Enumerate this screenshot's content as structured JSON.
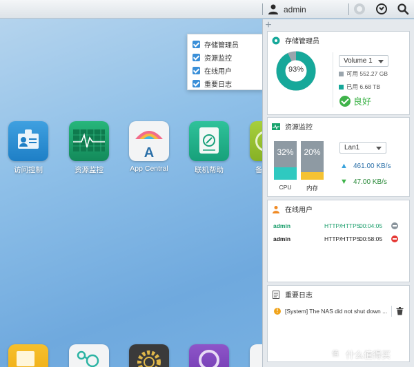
{
  "topbar": {
    "username": "admin",
    "icons": [
      "user-icon",
      "notification-icon",
      "options-icon",
      "search-icon"
    ]
  },
  "desktop": {
    "apps": [
      {
        "name": "access-control",
        "label": "访问控制"
      },
      {
        "name": "resource-monitor",
        "label": "资源监控"
      },
      {
        "name": "app-central",
        "label": "App Central"
      },
      {
        "name": "online-help",
        "label": "联机帮助"
      },
      {
        "name": "partial-app",
        "label": "备"
      }
    ]
  },
  "chooser": {
    "options": [
      "存储管理员",
      "资源监控",
      "在线用户",
      "重要日志"
    ]
  },
  "storage": {
    "title": "存储管理员",
    "percent": "93%",
    "percent_value": 93,
    "volume": "Volume 1",
    "available_label": "可用",
    "available_value": "552.27 GB",
    "used_label": "已用",
    "used_value": "6.68 TB",
    "status": "良好",
    "colors": {
      "used": "#16a89a",
      "free": "#9aa5ad"
    }
  },
  "resource": {
    "title": "资源监控",
    "cpu_percent": "32%",
    "cpu_value": 32,
    "cpu_label": "CPU",
    "mem_percent": "20%",
    "mem_value": 20,
    "mem_label": "内存",
    "lan": "Lan1",
    "upload": "461.00 KB/s",
    "download": "47.00 KB/s",
    "colors": {
      "cpu": "#2fc9c0",
      "mem": "#f5c233"
    }
  },
  "online": {
    "title": "在线用户",
    "users": [
      {
        "name": "admin",
        "protocol": "HTTP/HTTPS",
        "time": "00:04:05",
        "color": "#1a9e6b",
        "btn": "#8a949c"
      },
      {
        "name": "admin",
        "protocol": "HTTP/HTTPS",
        "time": "00:58:05",
        "color": "#222222",
        "btn": "#e53935"
      }
    ]
  },
  "log": {
    "title": "重要日志",
    "message": "[System] The NAS did not shut down ..."
  },
  "watermark": {
    "badge": "值",
    "text": "什么值得买"
  }
}
